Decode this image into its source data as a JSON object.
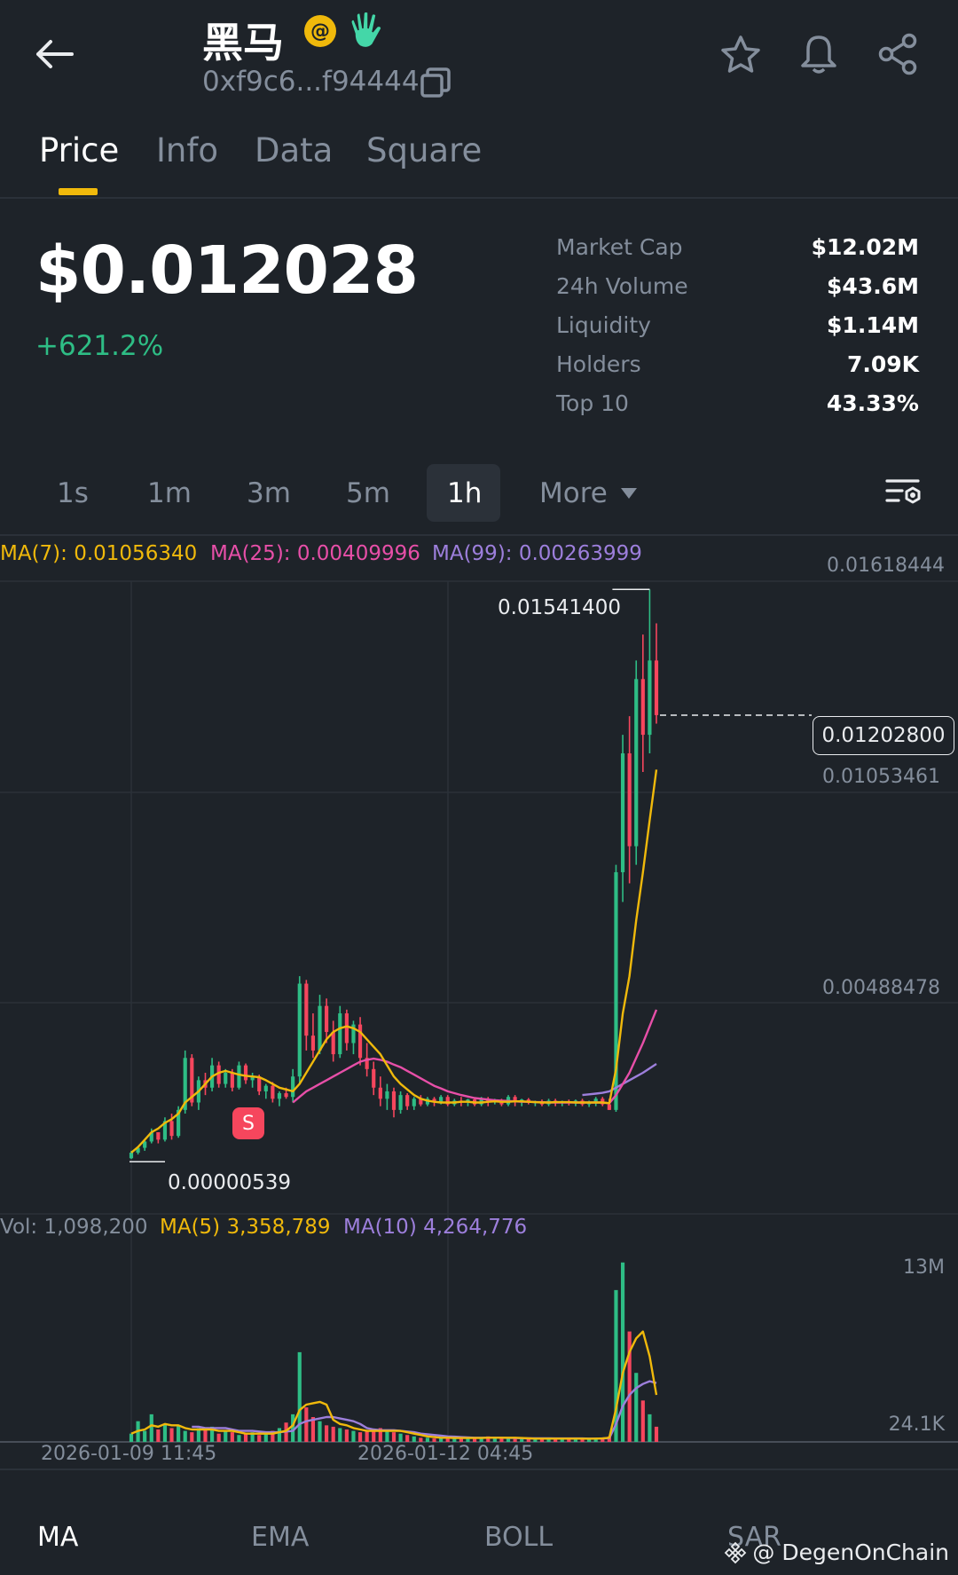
{
  "header": {
    "title": "黑马",
    "address": "0xf9c6...f94444"
  },
  "tabs": [
    "Price",
    "Info",
    "Data",
    "Square"
  ],
  "price": {
    "value": "$0.012028",
    "change": "+621.2%"
  },
  "stats": [
    {
      "label": "Market Cap",
      "value": "$12.02M"
    },
    {
      "label": "24h Volume",
      "value": "$43.6M"
    },
    {
      "label": "Liquidity",
      "value": "$1.14M"
    },
    {
      "label": "Holders",
      "value": "7.09K"
    },
    {
      "label": "Top 10",
      "value": "43.33%"
    }
  ],
  "intervals": {
    "items": [
      "1s",
      "1m",
      "3m",
      "5m",
      "1h"
    ],
    "more": "More",
    "active": "1h"
  },
  "legend": {
    "ma7": "MA(7): 0.01056340",
    "ma25": "MA(25): 0.00409996",
    "ma99": "MA(99): 0.00263999",
    "vol": "Vol: 1,098,200",
    "vol_ma5": "MA(5) 3,358,789",
    "vol_ma10": "MA(10) 4,264,776"
  },
  "colors": {
    "up": "#2ebd85",
    "down": "#f6465d",
    "ma7": "#f0b90b",
    "ma25": "#e74fa8",
    "ma99": "#9d7fdc",
    "accent": "#f0b90b"
  },
  "chart_data": {
    "type": "candlestick",
    "axis_labels": [
      "0.01618444",
      "0.01053461",
      "0.00488478"
    ],
    "current_price_label": "0.01202800",
    "high_label": "0.01541400",
    "low_label": "0.00000539",
    "sell_marker": "S",
    "volume_axis_labels": [
      "13M",
      "24.1K"
    ],
    "x_labels": [
      "2026-01-09 11:45",
      "2026-01-12 04:45"
    ],
    "ohlc": [
      [
        0.0001,
        0.0003,
        8e-05,
        0.00025
      ],
      [
        0.00025,
        0.0004,
        0.0002,
        0.00038
      ],
      [
        0.00038,
        0.0006,
        0.0003,
        0.00055
      ],
      [
        0.00055,
        0.0009,
        0.0005,
        0.0008
      ],
      [
        0.0008,
        0.0007,
        0.0005,
        0.0006
      ],
      [
        0.0006,
        0.0012,
        0.00055,
        0.0011
      ],
      [
        0.0011,
        0.0013,
        0.0006,
        0.0007
      ],
      [
        0.0007,
        0.0015,
        0.00065,
        0.0014
      ],
      [
        0.0014,
        0.003,
        0.0013,
        0.0028
      ],
      [
        0.0028,
        0.0029,
        0.0015,
        0.0016
      ],
      [
        0.0016,
        0.0023,
        0.0014,
        0.0022
      ],
      [
        0.0022,
        0.0024,
        0.0018,
        0.002
      ],
      [
        0.002,
        0.0028,
        0.0019,
        0.0026
      ],
      [
        0.0026,
        0.0027,
        0.002,
        0.0021
      ],
      [
        0.0021,
        0.0025,
        0.002,
        0.0024
      ],
      [
        0.0024,
        0.0025,
        0.0019,
        0.002
      ],
      [
        0.002,
        0.0027,
        0.00195,
        0.0026
      ],
      [
        0.0026,
        0.00265,
        0.0021,
        0.0022
      ],
      [
        0.0022,
        0.0024,
        0.002,
        0.0023
      ],
      [
        0.0023,
        0.00235,
        0.0018,
        0.0019
      ],
      [
        0.0019,
        0.0021,
        0.0017,
        0.00205
      ],
      [
        0.00205,
        0.00215,
        0.0016,
        0.0017
      ],
      [
        0.0017,
        0.0019,
        0.0015,
        0.00185
      ],
      [
        0.00185,
        0.002,
        0.0017,
        0.00175
      ],
      [
        0.00175,
        0.0025,
        0.0016,
        0.0023
      ],
      [
        0.0023,
        0.005,
        0.0021,
        0.0048
      ],
      [
        0.0048,
        0.0049,
        0.003,
        0.0034
      ],
      [
        0.0034,
        0.004,
        0.0028,
        0.003
      ],
      [
        0.003,
        0.0045,
        0.0029,
        0.0042
      ],
      [
        0.0042,
        0.0044,
        0.0032,
        0.0035
      ],
      [
        0.0035,
        0.0038,
        0.0027,
        0.0029
      ],
      [
        0.0029,
        0.0042,
        0.0028,
        0.004
      ],
      [
        0.004,
        0.0041,
        0.003,
        0.0032
      ],
      [
        0.0032,
        0.0038,
        0.0029,
        0.0037
      ],
      [
        0.0037,
        0.0039,
        0.0026,
        0.0028
      ],
      [
        0.0028,
        0.0032,
        0.0023,
        0.0025
      ],
      [
        0.0025,
        0.0027,
        0.0018,
        0.002
      ],
      [
        0.002,
        0.0023,
        0.0015,
        0.0017
      ],
      [
        0.0017,
        0.0021,
        0.0014,
        0.0019
      ],
      [
        0.0019,
        0.002,
        0.0012,
        0.0014
      ],
      [
        0.0014,
        0.0019,
        0.0013,
        0.0018
      ],
      [
        0.0018,
        0.00185,
        0.0014,
        0.0015
      ],
      [
        0.0015,
        0.00175,
        0.0014,
        0.0017
      ],
      [
        0.0017,
        0.0018,
        0.0015,
        0.00155
      ],
      [
        0.00155,
        0.00175,
        0.0015,
        0.0017
      ],
      [
        0.0017,
        0.00175,
        0.0015,
        0.0016
      ],
      [
        0.0016,
        0.0018,
        0.00155,
        0.00175
      ],
      [
        0.00175,
        0.0018,
        0.0015,
        0.00155
      ],
      [
        0.00155,
        0.0017,
        0.0015,
        0.00165
      ],
      [
        0.00165,
        0.00175,
        0.0015,
        0.0016
      ],
      [
        0.0016,
        0.0017,
        0.0015,
        0.00168
      ],
      [
        0.00168,
        0.0017,
        0.0015,
        0.00155
      ],
      [
        0.00155,
        0.00175,
        0.0015,
        0.0017
      ],
      [
        0.0017,
        0.00175,
        0.0015,
        0.0016
      ],
      [
        0.0016,
        0.0017,
        0.00155,
        0.00165
      ],
      [
        0.00165,
        0.0017,
        0.0015,
        0.00155
      ],
      [
        0.00155,
        0.0018,
        0.0015,
        0.00175
      ],
      [
        0.00175,
        0.0018,
        0.0015,
        0.0016
      ],
      [
        0.0016,
        0.0017,
        0.0015,
        0.00168
      ],
      [
        0.00168,
        0.00172,
        0.00155,
        0.0016
      ],
      [
        0.0016,
        0.00165,
        0.0015,
        0.00162
      ],
      [
        0.00162,
        0.00168,
        0.0015,
        0.00155
      ],
      [
        0.00155,
        0.0017,
        0.0015,
        0.00165
      ],
      [
        0.00165,
        0.0017,
        0.0015,
        0.00158
      ],
      [
        0.00158,
        0.00165,
        0.0015,
        0.00162
      ],
      [
        0.00162,
        0.00168,
        0.00152,
        0.0016
      ],
      [
        0.0016,
        0.00168,
        0.0015,
        0.00165
      ],
      [
        0.00165,
        0.0017,
        0.0015,
        0.00155
      ],
      [
        0.00155,
        0.00165,
        0.00148,
        0.0016
      ],
      [
        0.0016,
        0.00175,
        0.0015,
        0.0017
      ],
      [
        0.0017,
        0.00175,
        0.0015,
        0.00155
      ],
      [
        0.00155,
        0.0017,
        0.0014,
        0.0014
      ],
      [
        0.0014,
        0.008,
        0.00135,
        0.0078
      ],
      [
        0.0078,
        0.0115,
        0.007,
        0.011
      ],
      [
        0.011,
        0.012,
        0.0075,
        0.0085
      ],
      [
        0.0085,
        0.0135,
        0.008,
        0.013
      ],
      [
        0.013,
        0.0142,
        0.0105,
        0.0115
      ],
      [
        0.0115,
        0.01541,
        0.011,
        0.0135
      ],
      [
        0.0135,
        0.0145,
        0.0118,
        0.01203
      ]
    ],
    "ma7": [
      0.00025,
      0.0004,
      0.0006,
      0.0008,
      0.0009,
      0.00105,
      0.00115,
      0.0013,
      0.0016,
      0.00175,
      0.0019,
      0.0021,
      0.0023,
      0.0024,
      0.00245,
      0.0024,
      0.00235,
      0.00232,
      0.0023,
      0.00228,
      0.0022,
      0.0021,
      0.002,
      0.00195,
      0.0019,
      0.0021,
      0.0024,
      0.0027,
      0.003,
      0.0033,
      0.0035,
      0.0036,
      0.00365,
      0.0036,
      0.0035,
      0.0033,
      0.0031,
      0.0029,
      0.0026,
      0.0023,
      0.0021,
      0.00195,
      0.0018,
      0.0017,
      0.00165,
      0.00162,
      0.0016,
      0.0016,
      0.0016,
      0.00162,
      0.00162,
      0.0016,
      0.0016,
      0.00162,
      0.00163,
      0.00162,
      0.00162,
      0.00163,
      0.00163,
      0.00162,
      0.00161,
      0.0016,
      0.0016,
      0.00161,
      0.00161,
      0.00161,
      0.0016,
      0.0016,
      0.0016,
      0.0016,
      0.0016,
      0.00158,
      0.0025,
      0.004,
      0.005,
      0.0065,
      0.0078,
      0.0092,
      0.01056
    ],
    "ma25": [
      null,
      null,
      null,
      null,
      null,
      null,
      null,
      null,
      null,
      null,
      null,
      null,
      null,
      null,
      null,
      null,
      null,
      null,
      null,
      null,
      null,
      null,
      null,
      null,
      0.0016,
      0.00175,
      0.0019,
      0.002,
      0.0021,
      0.0022,
      0.0023,
      0.0024,
      0.0025,
      0.0026,
      0.0027,
      0.00275,
      0.00278,
      0.00275,
      0.0027,
      0.00262,
      0.00255,
      0.00245,
      0.00235,
      0.00225,
      0.00215,
      0.00205,
      0.00198,
      0.0019,
      0.00185,
      0.0018,
      0.00176,
      0.00172,
      0.0017,
      0.00168,
      0.00166,
      0.00165,
      0.00164,
      0.00163,
      0.00162,
      0.00162,
      0.00161,
      0.00161,
      0.0016,
      0.0016,
      0.0016,
      0.0016,
      0.0016,
      0.0016,
      0.0016,
      0.0016,
      0.0016,
      0.00158,
      0.0018,
      0.0021,
      0.0024,
      0.0028,
      0.0032,
      0.00365,
      0.0041
    ],
    "ma99": [
      null,
      null,
      null,
      null,
      null,
      null,
      null,
      null,
      null,
      null,
      null,
      null,
      null,
      null,
      null,
      null,
      null,
      null,
      null,
      null,
      null,
      null,
      null,
      null,
      null,
      null,
      null,
      null,
      null,
      null,
      null,
      null,
      null,
      null,
      null,
      null,
      null,
      null,
      null,
      null,
      null,
      null,
      null,
      null,
      null,
      null,
      null,
      null,
      null,
      null,
      null,
      null,
      null,
      null,
      null,
      null,
      null,
      null,
      null,
      null,
      null,
      null,
      null,
      null,
      null,
      null,
      null,
      0.0018,
      0.00182,
      0.00184,
      0.00186,
      0.0019,
      0.002,
      0.0021,
      0.0022,
      0.0023,
      0.0024,
      0.00252,
      0.00264
    ],
    "volume": [
      0.6,
      1.5,
      0.8,
      2.0,
      0.9,
      1.3,
      1.0,
      1.2,
      0.8,
      0.7,
      1.0,
      0.9,
      1.1,
      0.6,
      0.8,
      0.7,
      0.5,
      0.6,
      0.7,
      0.5,
      0.6,
      0.8,
      1.0,
      1.4,
      2.0,
      6.5,
      2.5,
      1.8,
      1.5,
      1.2,
      1.1,
      1.0,
      0.9,
      0.8,
      0.7,
      0.8,
      0.9,
      1.0,
      0.8,
      0.7,
      0.6,
      0.5,
      0.4,
      0.3,
      0.3,
      0.25,
      0.3,
      0.3,
      0.25,
      0.3,
      0.25,
      0.3,
      0.3,
      0.4,
      0.3,
      0.25,
      0.3,
      0.3,
      0.25,
      0.2,
      0.25,
      0.2,
      0.25,
      0.3,
      0.2,
      0.25,
      0.2,
      0.3,
      0.2,
      0.25,
      0.3,
      0.4,
      11.0,
      13.0,
      8.0,
      5.0,
      3.0,
      2.0,
      1.1
    ],
    "vol_ma5": [
      0.6,
      0.8,
      0.9,
      1.2,
      1.1,
      1.3,
      1.2,
      1.2,
      1.0,
      0.9,
      0.9,
      0.9,
      0.9,
      0.8,
      0.8,
      0.8,
      0.7,
      0.6,
      0.6,
      0.6,
      0.6,
      0.6,
      0.7,
      0.8,
      1.2,
      2.3,
      2.7,
      2.8,
      2.9,
      2.7,
      1.6,
      1.3,
      1.2,
      1.0,
      0.9,
      0.8,
      0.8,
      0.8,
      0.8,
      0.8,
      0.8,
      0.7,
      0.6,
      0.5,
      0.4,
      0.35,
      0.3,
      0.3,
      0.28,
      0.28,
      0.28,
      0.28,
      0.28,
      0.3,
      0.3,
      0.3,
      0.3,
      0.3,
      0.28,
      0.26,
      0.24,
      0.24,
      0.24,
      0.24,
      0.24,
      0.24,
      0.24,
      0.24,
      0.23,
      0.24,
      0.25,
      0.3,
      2.4,
      5.0,
      6.5,
      7.5,
      8.0,
      6.2,
      3.4
    ],
    "vol_ma10": [
      null,
      null,
      null,
      null,
      null,
      null,
      null,
      null,
      null,
      1.1,
      1.1,
      1.0,
      1.0,
      1.0,
      1.0,
      0.9,
      0.8,
      0.8,
      0.8,
      0.75,
      0.7,
      0.7,
      0.7,
      0.75,
      0.8,
      1.3,
      1.5,
      1.6,
      1.7,
      1.8,
      1.8,
      1.7,
      1.6,
      1.5,
      1.3,
      1.0,
      0.9,
      0.85,
      0.85,
      0.85,
      0.8,
      0.75,
      0.7,
      0.6,
      0.55,
      0.5,
      0.45,
      0.4,
      0.38,
      0.35,
      0.32,
      0.3,
      0.3,
      0.3,
      0.3,
      0.3,
      0.28,
      0.28,
      0.27,
      0.26,
      0.26,
      0.26,
      0.26,
      0.25,
      0.25,
      0.25,
      0.25,
      0.25,
      0.24,
      0.24,
      0.25,
      0.27,
      1.3,
      2.6,
      3.4,
      3.9,
      4.2,
      4.4,
      4.26
    ]
  },
  "indicators": [
    "MA",
    "EMA",
    "BOLL",
    "SAR"
  ],
  "watermark": "@ DegenOnChain"
}
